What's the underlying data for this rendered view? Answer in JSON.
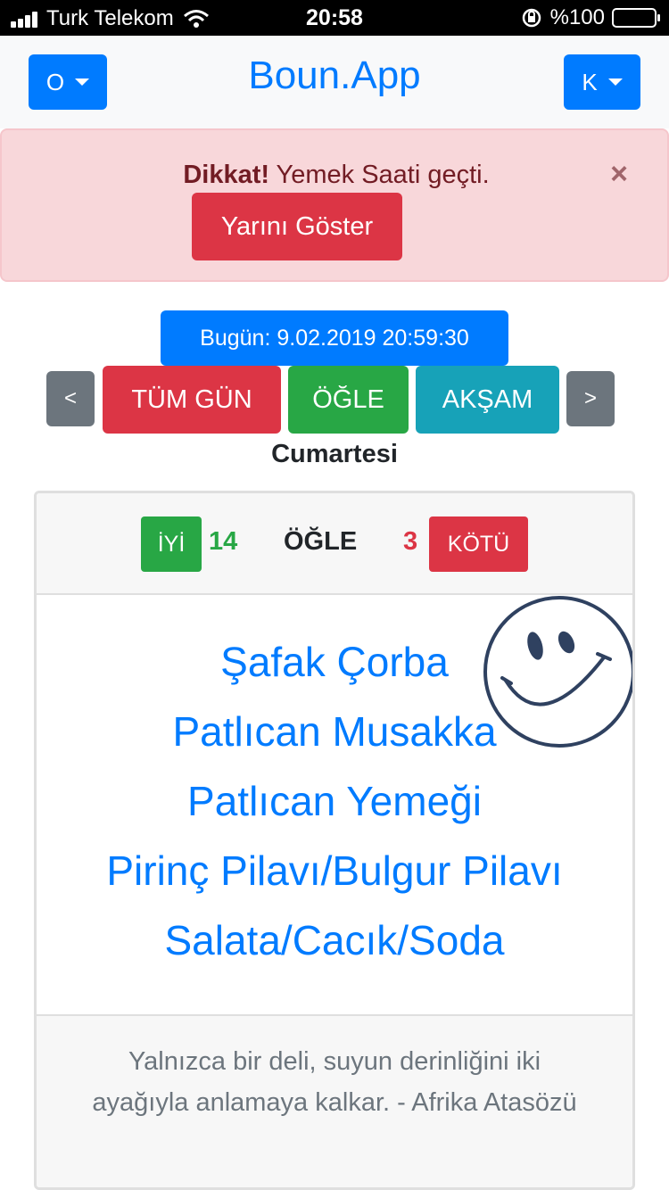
{
  "status_bar": {
    "carrier": "Turk Telekom",
    "time": "20:58",
    "battery": "%100",
    "icons": [
      "signal-icon",
      "wifi-icon",
      "orientation-lock-icon",
      "battery-icon"
    ]
  },
  "navbar": {
    "left_dropdown": "O",
    "brand": "Boun.App",
    "right_dropdown": "K"
  },
  "alert": {
    "strong": "Dikkat!",
    "message": " Yemek Saati geçti.",
    "close": "×",
    "button": "Yarını Göster"
  },
  "date": {
    "label": "Bugün: 9.02.2019 20:59:30"
  },
  "tabs": {
    "prev": "<",
    "all_day": "TÜM GÜN",
    "noon": "ÖĞLE",
    "evening": "AKŞAM",
    "next": ">"
  },
  "day": "Cumartesi",
  "card": {
    "good_label": "İYİ",
    "good_count": "14",
    "meal": "ÖĞLE",
    "bad_count": "3",
    "bad_label": "KÖTÜ",
    "menu": [
      "Şafak Çorba",
      "Patlıcan Musakka",
      "Patlıcan Yemeği",
      "Pirinç Pilavı/Bulgur Pilavı",
      "Salata/Cacık/Soda"
    ],
    "quote": "Yalnızca bir deli, suyun derinliğini iki ayağıyla anlamaya kalkar. - Afrika Atasözü"
  },
  "colors": {
    "primary": "#007bff",
    "danger": "#dc3545",
    "success": "#28a745",
    "info": "#17a2b8",
    "secondary": "#6c757d",
    "alert_bg": "#f8d7da",
    "smiley_stroke": "#2f4160"
  }
}
